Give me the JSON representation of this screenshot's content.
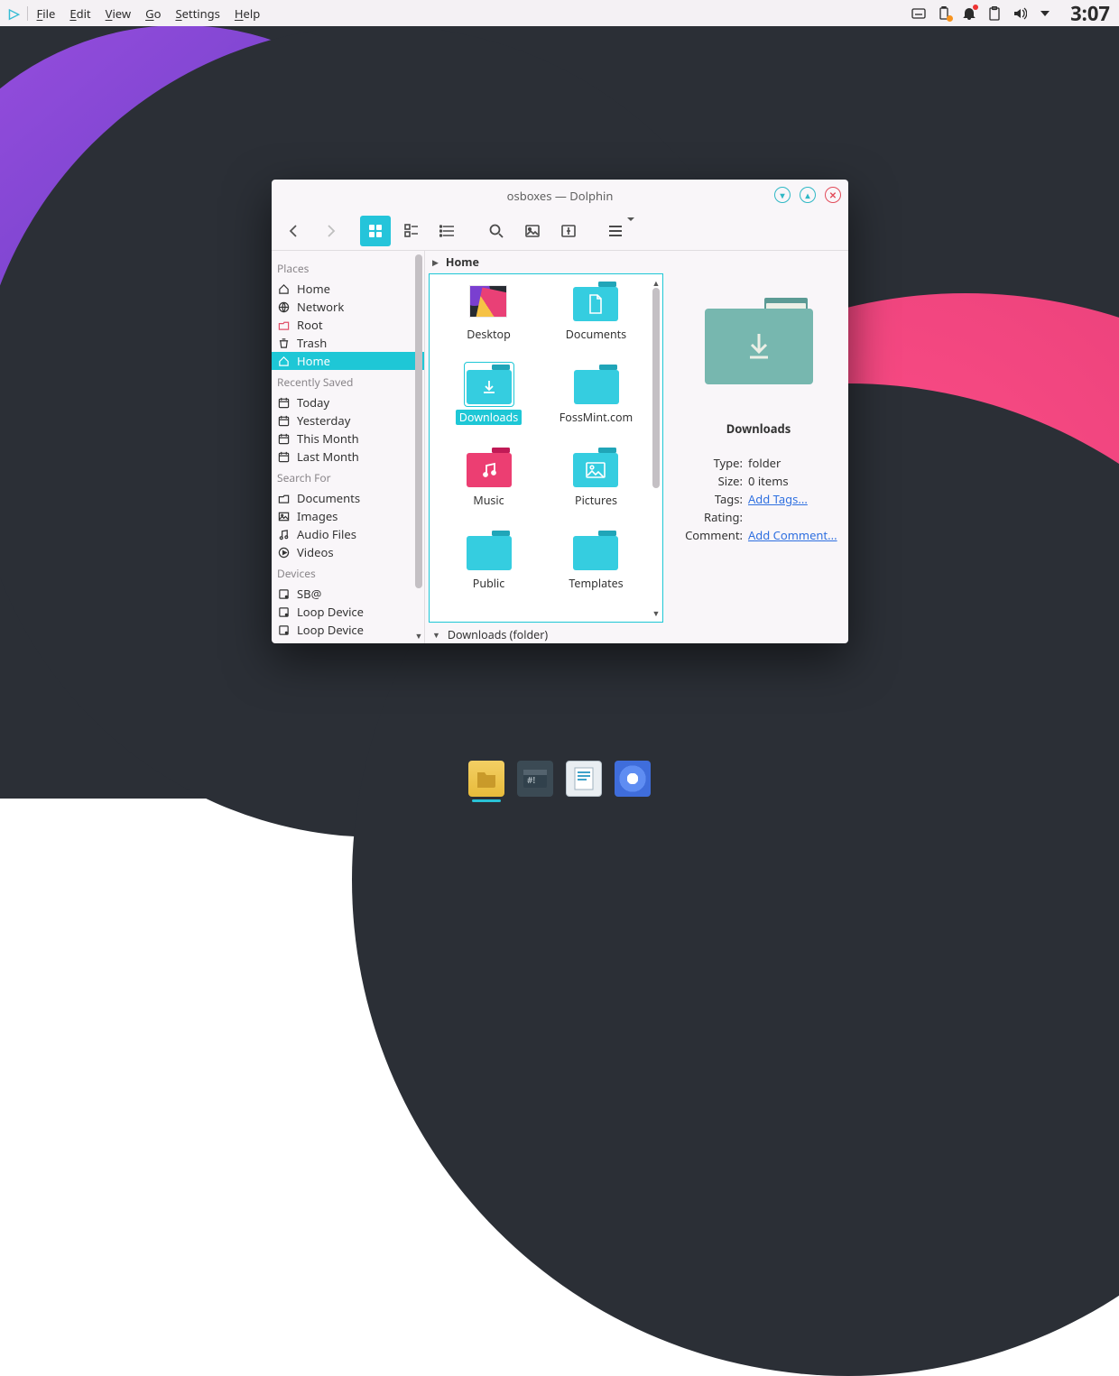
{
  "panel": {
    "menus": [
      "File",
      "Edit",
      "View",
      "Go",
      "Settings",
      "Help"
    ],
    "clock": "3:07"
  },
  "window": {
    "title": "osboxes — Dolphin",
    "breadcrumb": "Home",
    "folder_status": "Downloads (folder)"
  },
  "sidebar": {
    "sections": [
      {
        "title": "Places",
        "items": [
          {
            "icon": "home",
            "label": "Home"
          },
          {
            "icon": "network",
            "label": "Network"
          },
          {
            "icon": "root",
            "label": "Root"
          },
          {
            "icon": "trash",
            "label": "Trash"
          },
          {
            "icon": "home",
            "label": "Home",
            "selected": true
          }
        ]
      },
      {
        "title": "Recently Saved",
        "items": [
          {
            "icon": "cal",
            "label": "Today"
          },
          {
            "icon": "cal",
            "label": "Yesterday"
          },
          {
            "icon": "cal",
            "label": "This Month"
          },
          {
            "icon": "cal",
            "label": "Last Month"
          }
        ]
      },
      {
        "title": "Search For",
        "items": [
          {
            "icon": "folder",
            "label": "Documents"
          },
          {
            "icon": "image",
            "label": "Images"
          },
          {
            "icon": "audio",
            "label": "Audio Files"
          },
          {
            "icon": "video",
            "label": "Videos"
          }
        ]
      },
      {
        "title": "Devices",
        "items": [
          {
            "icon": "disk",
            "label": "SB@"
          },
          {
            "icon": "disk",
            "label": "Loop Device"
          },
          {
            "icon": "disk",
            "label": "Loop Device"
          }
        ]
      }
    ]
  },
  "folders": [
    {
      "label": "Desktop",
      "kind": "desktop"
    },
    {
      "label": "Documents",
      "kind": "teal",
      "glyph": "doc"
    },
    {
      "label": "Downloads",
      "kind": "teal",
      "glyph": "dl",
      "selected": true
    },
    {
      "label": "FossMint.com",
      "kind": "teal",
      "glyph": ""
    },
    {
      "label": "Music",
      "kind": "pink",
      "glyph": "music"
    },
    {
      "label": "Pictures",
      "kind": "teal",
      "glyph": "pic"
    },
    {
      "label": "Public",
      "kind": "teal",
      "glyph": ""
    },
    {
      "label": "Templates",
      "kind": "teal",
      "glyph": ""
    }
  ],
  "details": {
    "title": "Downloads",
    "rows": {
      "type_k": "Type:",
      "type_v": "folder",
      "size_k": "Size:",
      "size_v": "0 items",
      "tags_k": "Tags:",
      "tags_v": "Add Tags...",
      "rating_k": "Rating:",
      "rating_v": "",
      "comment_k": "Comment:",
      "comment_v": "Add Comment..."
    }
  },
  "dock": [
    "files",
    "terminal",
    "document",
    "browser"
  ]
}
